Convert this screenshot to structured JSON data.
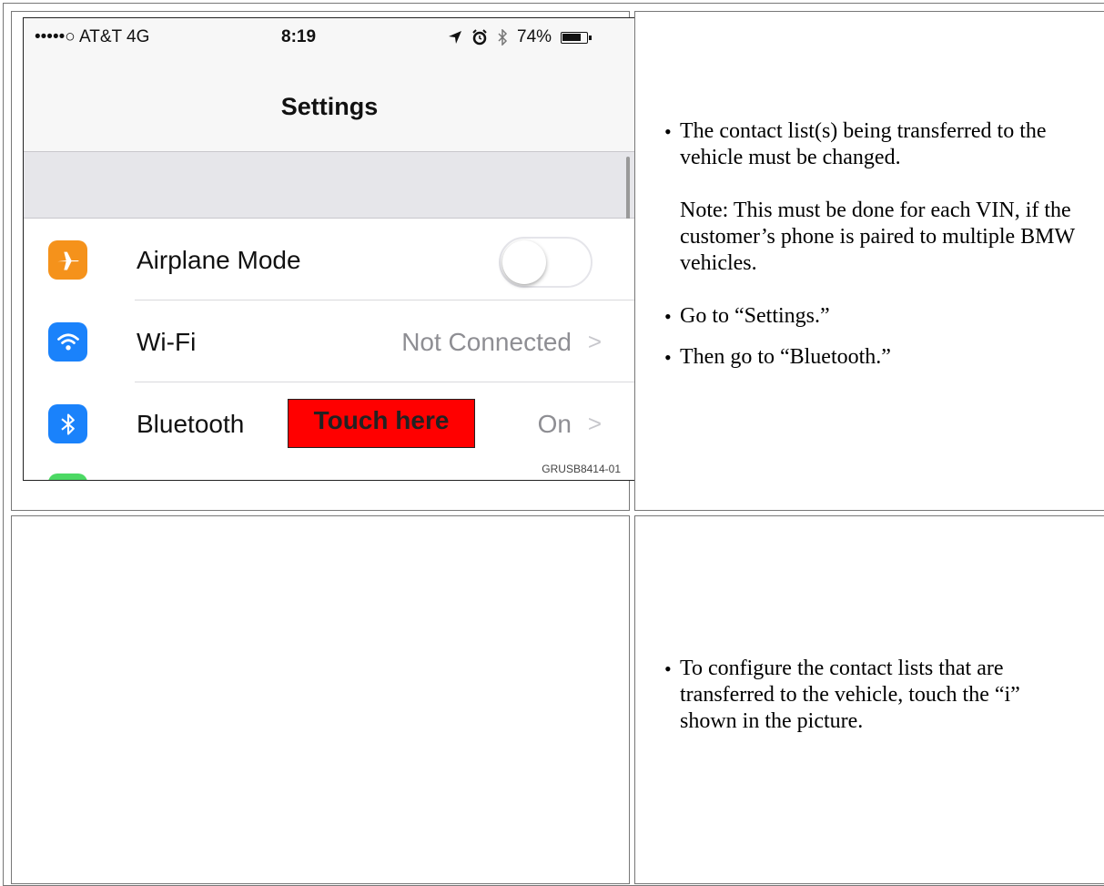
{
  "phone": {
    "status": {
      "left": "•••••○ AT&T  4G",
      "time": "8:19",
      "battery": "74%"
    },
    "title": "Settings",
    "rows": [
      {
        "label": "Airplane Mode",
        "icon": "airplane-icon",
        "icon_color": "#f5921b"
      },
      {
        "label": "Wi-Fi",
        "value": "Not Connected",
        "icon": "wifi-icon",
        "icon_color": "#1a82fb"
      },
      {
        "label": "Bluetooth",
        "value": "On",
        "icon": "bluetooth-icon",
        "icon_color": "#1a82fb",
        "callout": "Touch here"
      }
    ],
    "chevron": ">",
    "figure_code": "GRUSB8414-01"
  },
  "cell_top_right": {
    "items": [
      {
        "text": "The contact list(s) being transferred to the vehicle must be changed.",
        "note": "Note: This must be done for each VIN, if the customer’s phone is paired to multiple BMW vehicles."
      },
      {
        "text": "Go to “Settings.”"
      },
      {
        "text": "Then go to “Bluetooth.”"
      }
    ]
  },
  "cell_bottom_right": {
    "items": [
      {
        "text": "To configure the contact lists that are transferred to the vehicle, touch the “i” shown in the picture."
      }
    ]
  },
  "colors": {
    "callout": "#ff0000",
    "orange": "#f5921b",
    "blue": "#1a82fb"
  }
}
